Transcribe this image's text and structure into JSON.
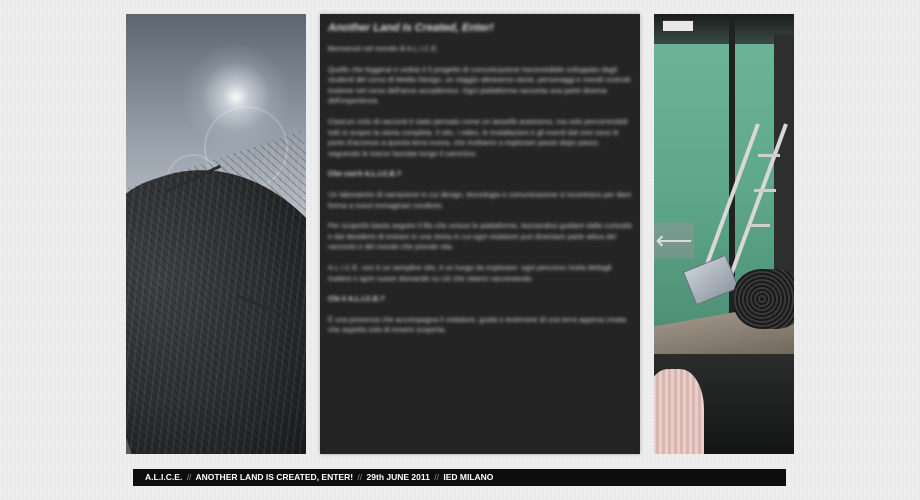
{
  "gallery": {
    "left_image": {
      "icon": "photo-sky-foliage"
    },
    "right_image": {
      "icon": "photo-green-screen-studio"
    },
    "prev_arrow": {
      "icon": "arrow-left-icon",
      "glyph": "⟵"
    }
  },
  "article": {
    "title": "Another Land Is Created, Enter!",
    "paragraphs": [
      {
        "text": "Benvenuti nel mondo di A.L.I.C.E.",
        "emphasis": false
      },
      {
        "text": "Quello che leggerai e vedrai è il progetto di comunicazione transmediale sviluppato dagli studenti del corso di Media Design, un viaggio attraverso storie, personaggi e mondi costruiti insieme nel corso dell'anno accademico. Ogni piattaforma racconta una parte diversa dell'esperienza.",
        "emphasis": false
      },
      {
        "text": "Ciascun ciclo di racconti è stato pensato come un tassello autonomo, ma solo percorrendoli tutti si scopre la storia completa. Il sito, i video, le installazioni e gli eventi dal vivo sono le porte d'accesso a questa terra nuova, che invitiamo a esplorare passo dopo passo, seguendo le tracce lasciate lungo il cammino.",
        "emphasis": false
      },
      {
        "text": "Che cos'è A.L.I.C.E.?",
        "emphasis": true
      },
      {
        "text": "Un laboratorio di narrazione in cui design, tecnologia e comunicazione si incontrano per dare forma a nuovi immaginari condivisi.",
        "emphasis": false
      },
      {
        "text": "Per scoprirlo basta seguire il filo che unisce le piattaforme, lasciandosi guidare dalla curiosità e dal desiderio di entrare in una storia in cui ogni visitatore può diventare parte attiva del racconto e del mondo che prende vita.",
        "emphasis": false
      },
      {
        "text": "A.L.I.C.E. non è un semplice sito, è un luogo da esplorare: ogni percorso rivela dettagli inattesi e apre nuove domande su ciò che stiamo raccontando.",
        "emphasis": false
      },
      {
        "text": "Chi è A.L.I.C.E.?",
        "emphasis": true
      },
      {
        "text": "È una presenza che accompagna il visitatore, guida e testimone di una terra appena creata che aspetta solo di essere scoperta.",
        "emphasis": false
      }
    ]
  },
  "footer": {
    "parts": [
      "A.L.I.C.E.",
      "ANOTHER LAND IS CREATED, ENTER!",
      "29th JUNE 2011",
      "IED MILANO"
    ],
    "separator": "//"
  }
}
